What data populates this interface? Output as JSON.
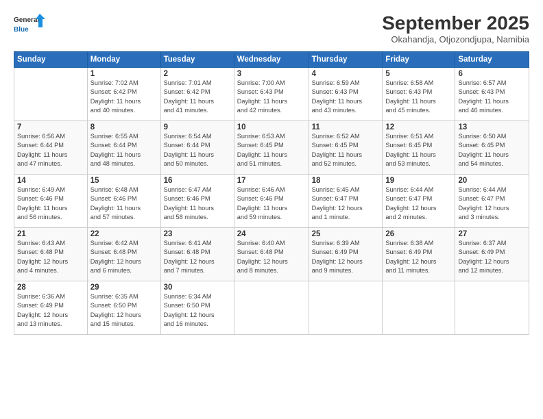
{
  "header": {
    "logo_line1": "General",
    "logo_line2": "Blue",
    "title": "September 2025",
    "location": "Okahandja, Otjozondjupa, Namibia"
  },
  "weekdays": [
    "Sunday",
    "Monday",
    "Tuesday",
    "Wednesday",
    "Thursday",
    "Friday",
    "Saturday"
  ],
  "weeks": [
    [
      {
        "day": "",
        "info": ""
      },
      {
        "day": "1",
        "info": "Sunrise: 7:02 AM\nSunset: 6:42 PM\nDaylight: 11 hours\nand 40 minutes."
      },
      {
        "day": "2",
        "info": "Sunrise: 7:01 AM\nSunset: 6:42 PM\nDaylight: 11 hours\nand 41 minutes."
      },
      {
        "day": "3",
        "info": "Sunrise: 7:00 AM\nSunset: 6:43 PM\nDaylight: 11 hours\nand 42 minutes."
      },
      {
        "day": "4",
        "info": "Sunrise: 6:59 AM\nSunset: 6:43 PM\nDaylight: 11 hours\nand 43 minutes."
      },
      {
        "day": "5",
        "info": "Sunrise: 6:58 AM\nSunset: 6:43 PM\nDaylight: 11 hours\nand 45 minutes."
      },
      {
        "day": "6",
        "info": "Sunrise: 6:57 AM\nSunset: 6:43 PM\nDaylight: 11 hours\nand 46 minutes."
      }
    ],
    [
      {
        "day": "7",
        "info": "Sunrise: 6:56 AM\nSunset: 6:44 PM\nDaylight: 11 hours\nand 47 minutes."
      },
      {
        "day": "8",
        "info": "Sunrise: 6:55 AM\nSunset: 6:44 PM\nDaylight: 11 hours\nand 48 minutes."
      },
      {
        "day": "9",
        "info": "Sunrise: 6:54 AM\nSunset: 6:44 PM\nDaylight: 11 hours\nand 50 minutes."
      },
      {
        "day": "10",
        "info": "Sunrise: 6:53 AM\nSunset: 6:45 PM\nDaylight: 11 hours\nand 51 minutes."
      },
      {
        "day": "11",
        "info": "Sunrise: 6:52 AM\nSunset: 6:45 PM\nDaylight: 11 hours\nand 52 minutes."
      },
      {
        "day": "12",
        "info": "Sunrise: 6:51 AM\nSunset: 6:45 PM\nDaylight: 11 hours\nand 53 minutes."
      },
      {
        "day": "13",
        "info": "Sunrise: 6:50 AM\nSunset: 6:45 PM\nDaylight: 11 hours\nand 54 minutes."
      }
    ],
    [
      {
        "day": "14",
        "info": "Sunrise: 6:49 AM\nSunset: 6:46 PM\nDaylight: 11 hours\nand 56 minutes."
      },
      {
        "day": "15",
        "info": "Sunrise: 6:48 AM\nSunset: 6:46 PM\nDaylight: 11 hours\nand 57 minutes."
      },
      {
        "day": "16",
        "info": "Sunrise: 6:47 AM\nSunset: 6:46 PM\nDaylight: 11 hours\nand 58 minutes."
      },
      {
        "day": "17",
        "info": "Sunrise: 6:46 AM\nSunset: 6:46 PM\nDaylight: 11 hours\nand 59 minutes."
      },
      {
        "day": "18",
        "info": "Sunrise: 6:45 AM\nSunset: 6:47 PM\nDaylight: 12 hours\nand 1 minute."
      },
      {
        "day": "19",
        "info": "Sunrise: 6:44 AM\nSunset: 6:47 PM\nDaylight: 12 hours\nand 2 minutes."
      },
      {
        "day": "20",
        "info": "Sunrise: 6:44 AM\nSunset: 6:47 PM\nDaylight: 12 hours\nand 3 minutes."
      }
    ],
    [
      {
        "day": "21",
        "info": "Sunrise: 6:43 AM\nSunset: 6:48 PM\nDaylight: 12 hours\nand 4 minutes."
      },
      {
        "day": "22",
        "info": "Sunrise: 6:42 AM\nSunset: 6:48 PM\nDaylight: 12 hours\nand 6 minutes."
      },
      {
        "day": "23",
        "info": "Sunrise: 6:41 AM\nSunset: 6:48 PM\nDaylight: 12 hours\nand 7 minutes."
      },
      {
        "day": "24",
        "info": "Sunrise: 6:40 AM\nSunset: 6:48 PM\nDaylight: 12 hours\nand 8 minutes."
      },
      {
        "day": "25",
        "info": "Sunrise: 6:39 AM\nSunset: 6:49 PM\nDaylight: 12 hours\nand 9 minutes."
      },
      {
        "day": "26",
        "info": "Sunrise: 6:38 AM\nSunset: 6:49 PM\nDaylight: 12 hours\nand 11 minutes."
      },
      {
        "day": "27",
        "info": "Sunrise: 6:37 AM\nSunset: 6:49 PM\nDaylight: 12 hours\nand 12 minutes."
      }
    ],
    [
      {
        "day": "28",
        "info": "Sunrise: 6:36 AM\nSunset: 6:49 PM\nDaylight: 12 hours\nand 13 minutes."
      },
      {
        "day": "29",
        "info": "Sunrise: 6:35 AM\nSunset: 6:50 PM\nDaylight: 12 hours\nand 15 minutes."
      },
      {
        "day": "30",
        "info": "Sunrise: 6:34 AM\nSunset: 6:50 PM\nDaylight: 12 hours\nand 16 minutes."
      },
      {
        "day": "",
        "info": ""
      },
      {
        "day": "",
        "info": ""
      },
      {
        "day": "",
        "info": ""
      },
      {
        "day": "",
        "info": ""
      }
    ]
  ]
}
